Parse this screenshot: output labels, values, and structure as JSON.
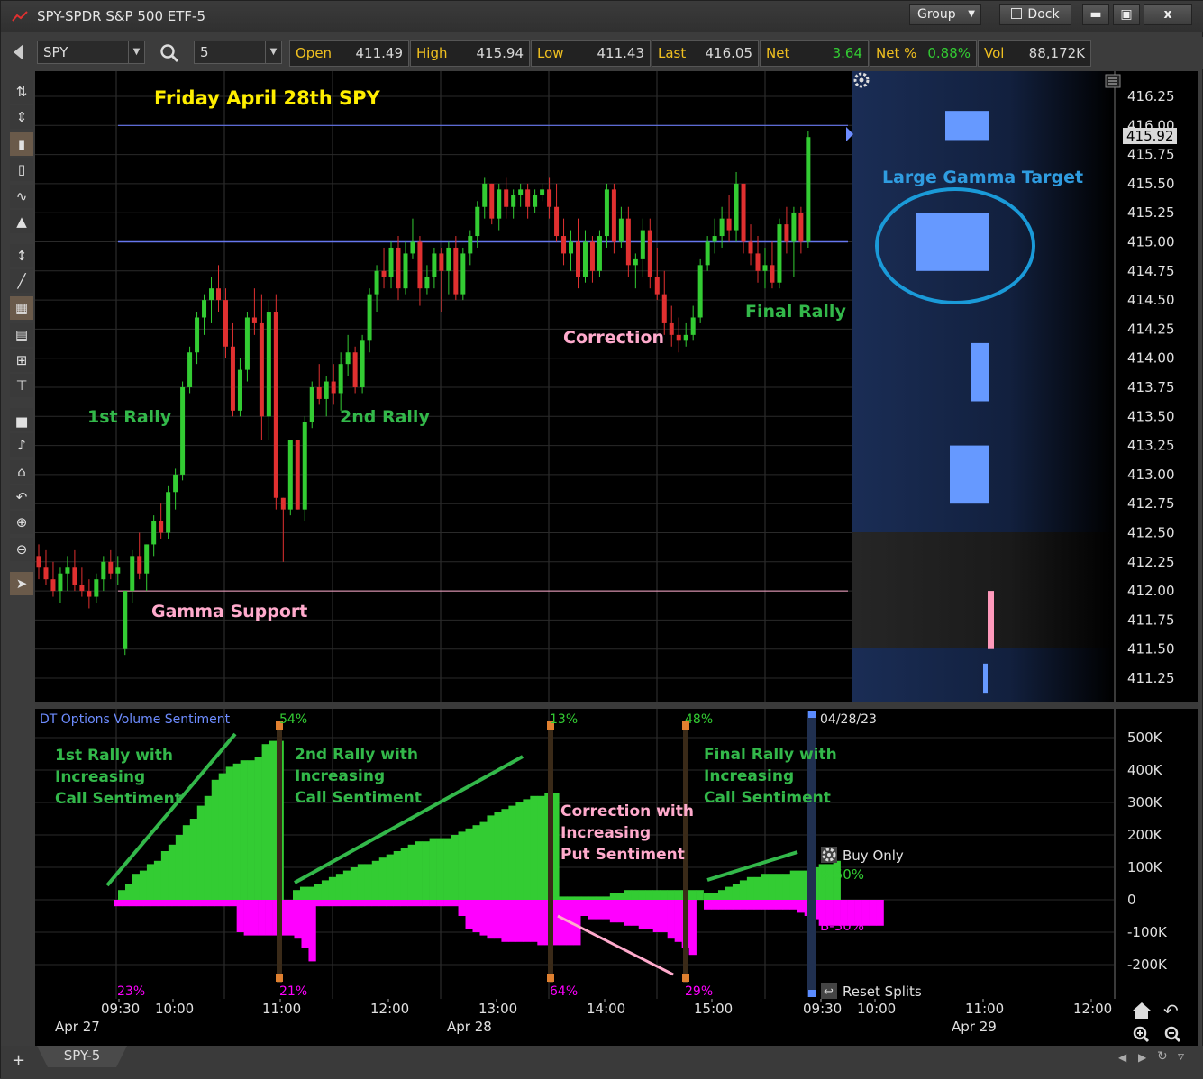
{
  "window": {
    "title": "SPY-SPDR S&P 500 ETF-5",
    "group_label": "Group",
    "dock_label": "Dock",
    "min_icon": "minimize-icon",
    "max_icon": "maximize-icon",
    "close_label": "x"
  },
  "toolbar": {
    "symbol": "SPY",
    "interval": "5",
    "quote": [
      {
        "label": "Open",
        "value": "411.49"
      },
      {
        "label": "High",
        "value": "415.94"
      },
      {
        "label": "Low",
        "value": "411.43"
      },
      {
        "label": "Last",
        "value": "416.05"
      },
      {
        "label": "Net",
        "value": "3.64"
      },
      {
        "label": "Net %",
        "value": "0.88%"
      },
      {
        "label": "Vol",
        "value": "88,172K"
      }
    ]
  },
  "price_chart": {
    "title": "Friday April 28th SPY",
    "last_price_label": "415.92",
    "annotations": {
      "rally1": "1st Rally",
      "rally2": "2nd Rally",
      "correction": "Correction",
      "final": "Final Rally",
      "gamma_support": "Gamma Support",
      "gamma_target": "Large Gamma Target"
    },
    "y_ticks": [
      "416.25",
      "416.00",
      "415.75",
      "415.50",
      "415.25",
      "415.00",
      "414.75",
      "414.50",
      "414.25",
      "414.00",
      "413.75",
      "413.50",
      "413.25",
      "413.00",
      "412.75",
      "412.50",
      "412.25",
      "412.00",
      "411.75",
      "411.50",
      "411.25"
    ]
  },
  "osc_chart": {
    "title": "DT Options Volume Sentiment",
    "date_label": "04/28/23",
    "buy_only_label": "Buy Only",
    "reset_splits_label": "Reset Splits",
    "b_pos_label": "B-50%",
    "b_neg_label": "B-30%",
    "y_ticks": [
      "500K",
      "400K",
      "300K",
      "200K",
      "100K",
      "0",
      "-100K",
      "-200K"
    ],
    "pct_labels": [
      {
        "top": "54%",
        "bottom": "21%"
      },
      {
        "top": "13%",
        "bottom": "64%"
      },
      {
        "top": "48%",
        "bottom": "29%"
      }
    ],
    "first_bottom_pct": "23%",
    "notes": {
      "n1": [
        "1st Rally with",
        "Increasing",
        "Call Sentiment"
      ],
      "n2": [
        "2nd Rally with",
        "Increasing",
        "Call Sentiment"
      ],
      "n3": [
        "Correction with",
        "Increasing",
        "Put Sentiment"
      ],
      "n4": [
        "Final Rally with",
        "Increasing",
        "Call Sentiment"
      ]
    }
  },
  "time_axis": {
    "times": [
      "09:30",
      "10:00",
      "11:00",
      "12:00",
      "13:00",
      "14:00",
      "15:00",
      "09:30",
      "10:00",
      "11:00",
      "12:00"
    ],
    "dates": [
      "Apr 27",
      "Apr 28",
      "Apr 29"
    ]
  },
  "bottom": {
    "tab_label": "SPY-5"
  },
  "colors": {
    "up": "#33cc33",
    "down": "#e03030",
    "magenta": "#ff00ff",
    "gamma_blue": "#6699ff",
    "annotation_green": "#33b84a",
    "annotation_pink": "#ffaacc",
    "title_yellow": "#ffee00"
  }
}
